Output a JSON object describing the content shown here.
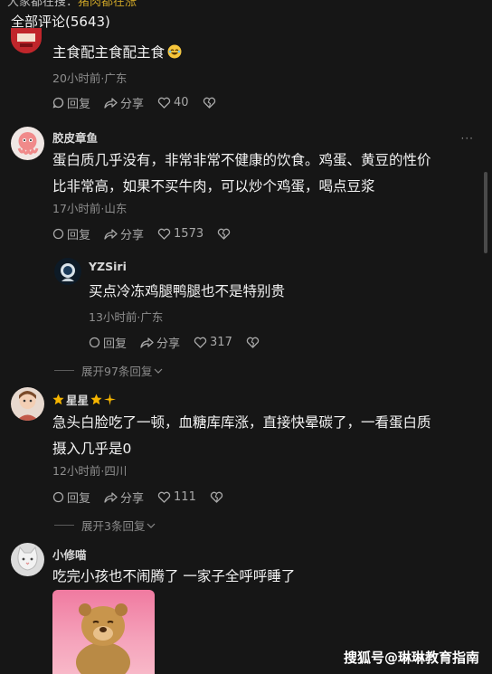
{
  "top_strip": {
    "prefix": "大家都在搜：",
    "highlight": "猪肉都在涨"
  },
  "header": {
    "title": "全部评论(5643)"
  },
  "comments": [
    {
      "text": "主食配主食配主食",
      "emoji_icon": "laughing-emoji-icon",
      "meta": "20小时前·广东",
      "reply_label": "回复",
      "share_label": "分享",
      "like_count": "40"
    },
    {
      "username": "胶皮章鱼",
      "line1": "蛋白质几乎没有，非常非常不健康的饮食。鸡蛋、黄豆的性价",
      "line2": "比非常高，如果不买牛肉，可以炒个鸡蛋，喝点豆浆",
      "meta": "17小时前·山东",
      "reply_label": "回复",
      "share_label": "分享",
      "like_count": "1573",
      "more": "···"
    },
    {
      "username": "YZSiri",
      "text": "买点冷冻鸡腿鸭腿也不是特别贵",
      "meta": "13小时前·广东",
      "reply_label": "回复",
      "share_label": "分享",
      "like_count": "317",
      "expand": "展开97条回复"
    },
    {
      "username": "星星",
      "line1": "急头白脸吃了一顿，血糖库库涨，直接快晕碳了，一看蛋白质",
      "line2": "摄入几乎是0",
      "meta": "12小时前·四川",
      "reply_label": "回复",
      "share_label": "分享",
      "like_count": "111",
      "expand": "展开3条回复"
    },
    {
      "username": "小修喵",
      "text": "吃完小孩也不闹腾了 一家子全呼呼睡了",
      "image_icon": "cartoon-bear-sticker"
    }
  ],
  "watermark": "搜狐号@琳琳教育指南",
  "colors": {
    "background": "#161616",
    "star": "#f5b400",
    "text": "#f3f3f3",
    "meta": "#8e8e8e"
  }
}
